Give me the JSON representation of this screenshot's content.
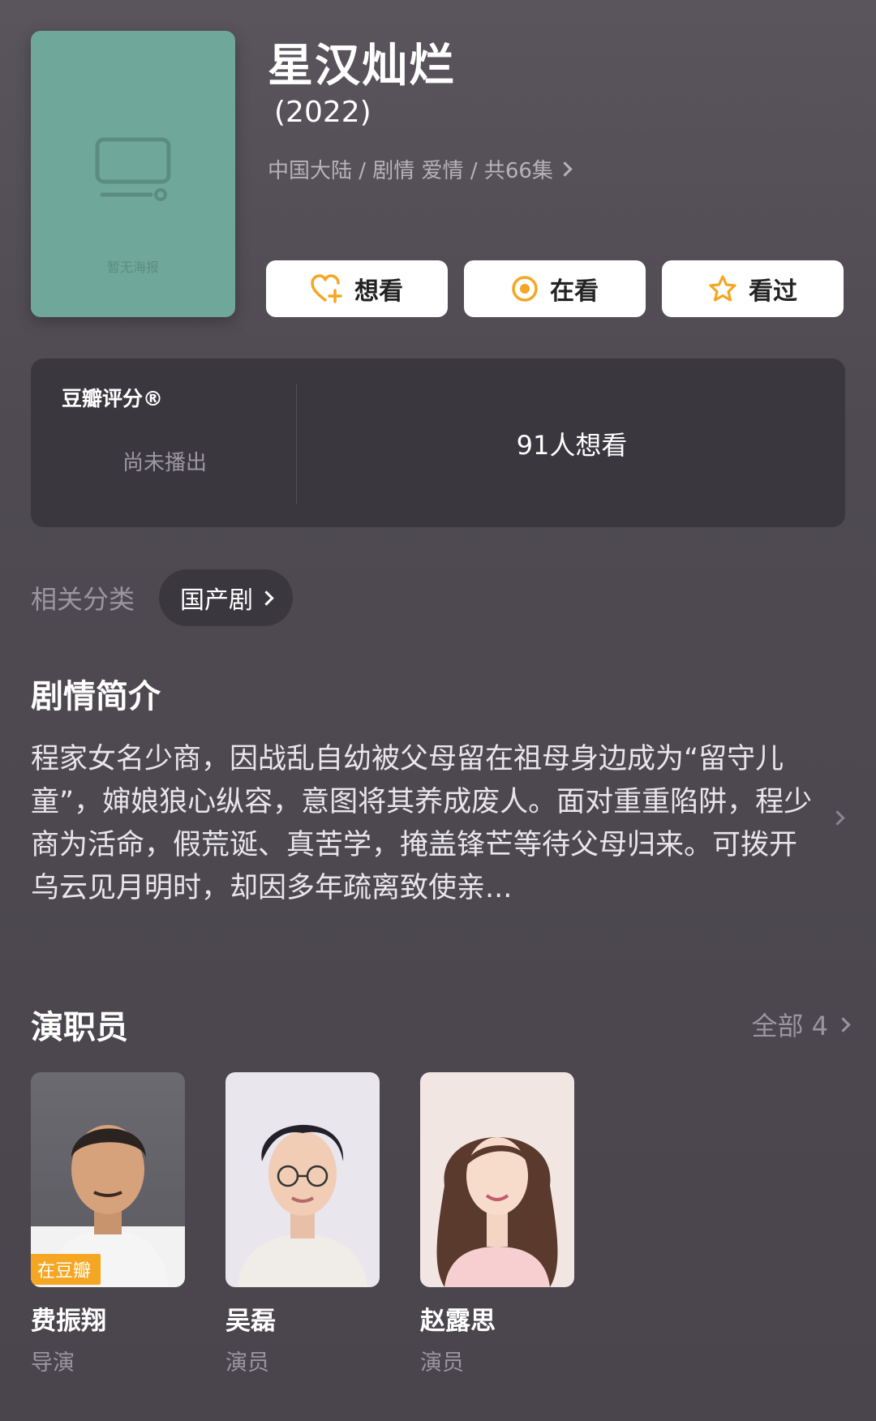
{
  "poster": {
    "placeholder_text": "暂无海报"
  },
  "title": "星汉灿烂",
  "year": "(2022)",
  "meta": "中国大陆 / 剧情 爱情 / 共66集",
  "actions": {
    "want": "想看",
    "watching": "在看",
    "watched": "看过"
  },
  "rating": {
    "label": "豆瓣评分®",
    "status": "尚未播出",
    "want_count": "91人想看"
  },
  "related": {
    "label": "相关分类",
    "chip": "国产剧"
  },
  "synopsis": {
    "title": "剧情简介",
    "text": "程家女名少商，因战乱自幼被父母留在祖母身边成为“留守儿童”，婶娘狼心纵容，意图将其养成废人。面对重重陷阱，程少商为活命，假荒诞、真苦学，掩盖锋芒等待父母归来。可拨开乌云见月明时，却因多年疏离致使亲..."
  },
  "cast": {
    "title": "演职员",
    "all_label": "全部 4",
    "members": [
      {
        "name": "费振翔",
        "role": "导演",
        "badge": "在豆瓣"
      },
      {
        "name": "吴磊",
        "role": "演员"
      },
      {
        "name": "赵露思",
        "role": "演员"
      }
    ]
  },
  "colors": {
    "accent": "#f5a623",
    "poster": "#6fa89a",
    "card": "#3b373f"
  }
}
